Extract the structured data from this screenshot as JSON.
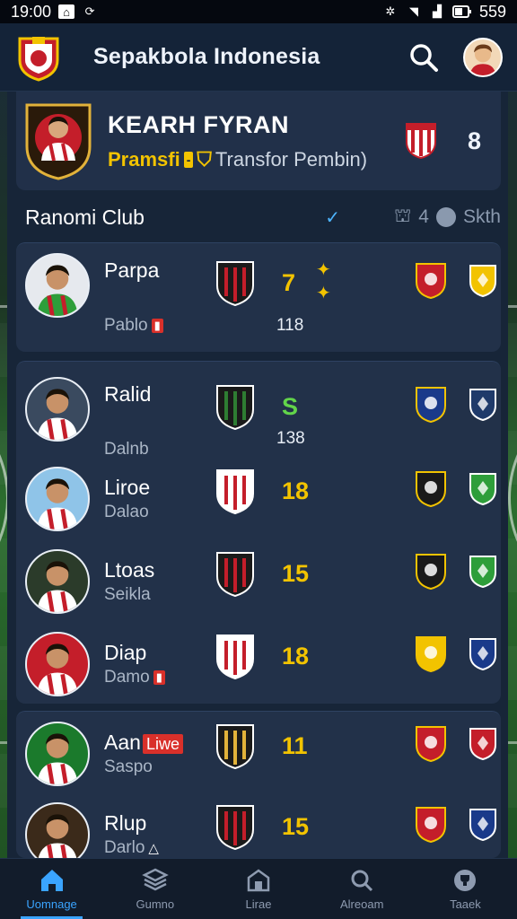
{
  "status_bar": {
    "time": "19:00",
    "battery": "559"
  },
  "app": {
    "title": "Sepakbola Indonesia"
  },
  "featured": {
    "name": "KEARH FYRAN",
    "highlight": "Pramsfi",
    "tag": "-",
    "transfer_text": "Transfor Pembin)",
    "count": "8"
  },
  "section": {
    "title": "Ranomi Club",
    "meta_count": "4",
    "meta_label": "Skth"
  },
  "players": [
    {
      "name": "Parpa",
      "sub": "Pablo",
      "number": "7",
      "stat": "118",
      "number_color": "yellow",
      "has_tag": true,
      "has_stars": true
    },
    {
      "name": "Ralid",
      "sub": "Dalnb",
      "number": "S",
      "stat": "138",
      "number_color": "green",
      "has_tag": false,
      "has_stars": false
    },
    {
      "name": "Liroe",
      "sub": "Dalao",
      "number": "18",
      "stat": "",
      "number_color": "yellow",
      "has_tag": false,
      "has_stars": false
    },
    {
      "name": "Ltoas",
      "sub": "Seikla",
      "number": "15",
      "stat": "",
      "number_color": "yellow",
      "has_tag": false,
      "has_stars": false
    },
    {
      "name": "Diap",
      "sub": "Damo",
      "number": "18",
      "stat": "",
      "number_color": "yellow",
      "has_tag": true,
      "has_stars": false
    },
    {
      "name": "Aan",
      "sub": "Saspo",
      "number": "11",
      "stat": "",
      "number_color": "yellow",
      "has_tag": false,
      "live_label": "Liwe",
      "has_stars": false
    },
    {
      "name": "Rlup",
      "sub": "Darlo",
      "number": "15",
      "stat": "",
      "number_color": "yellow",
      "has_tag": false,
      "has_stars": false
    }
  ],
  "nav": [
    {
      "label": "Uomnage",
      "icon": "home-icon",
      "active": true
    },
    {
      "label": "Gumno",
      "icon": "layers-icon",
      "active": false
    },
    {
      "label": "Lirae",
      "icon": "club-icon",
      "active": false
    },
    {
      "label": "Alreoam",
      "icon": "search-ball-icon",
      "active": false
    },
    {
      "label": "Taaek",
      "icon": "trophy-icon",
      "active": false
    }
  ],
  "colors": {
    "accent": "#3aa4ff",
    "gold": "#f2c300",
    "green": "#62d44a",
    "card": "#223149",
    "header": "#142338"
  }
}
